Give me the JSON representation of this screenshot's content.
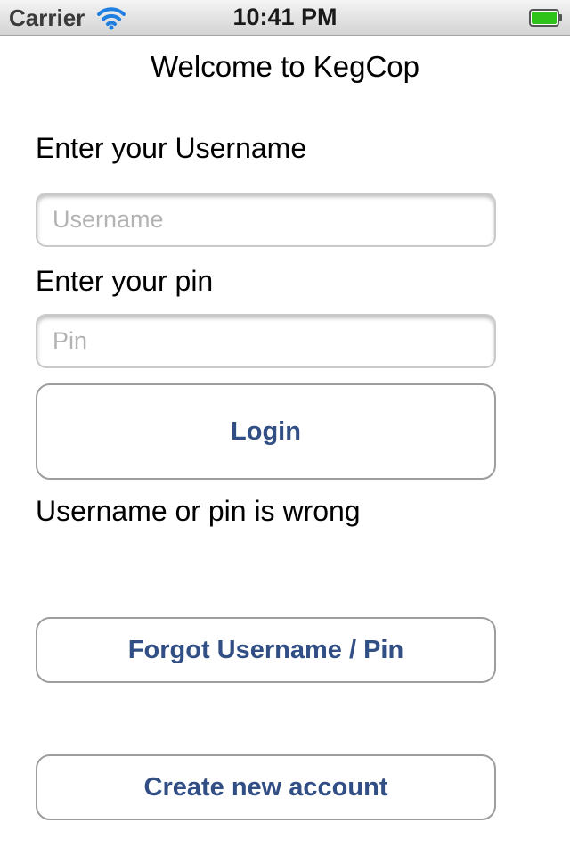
{
  "status_bar": {
    "carrier": "Carrier",
    "time": "10:41 PM",
    "wifi_icon": "wifi-icon",
    "battery_icon": "battery-icon",
    "battery_color": "#2ec21a"
  },
  "login": {
    "title": "Welcome to KegCop",
    "username_label": "Enter your Username",
    "username_placeholder": "Username",
    "username_value": "",
    "pin_label": "Enter your pin",
    "pin_placeholder": "Pin",
    "pin_value": "",
    "login_button": "Login",
    "error_message": "Username or pin is wrong",
    "forgot_button": "Forgot Username / Pin",
    "create_button": "Create new account"
  },
  "colors": {
    "button_text": "#324f85"
  }
}
